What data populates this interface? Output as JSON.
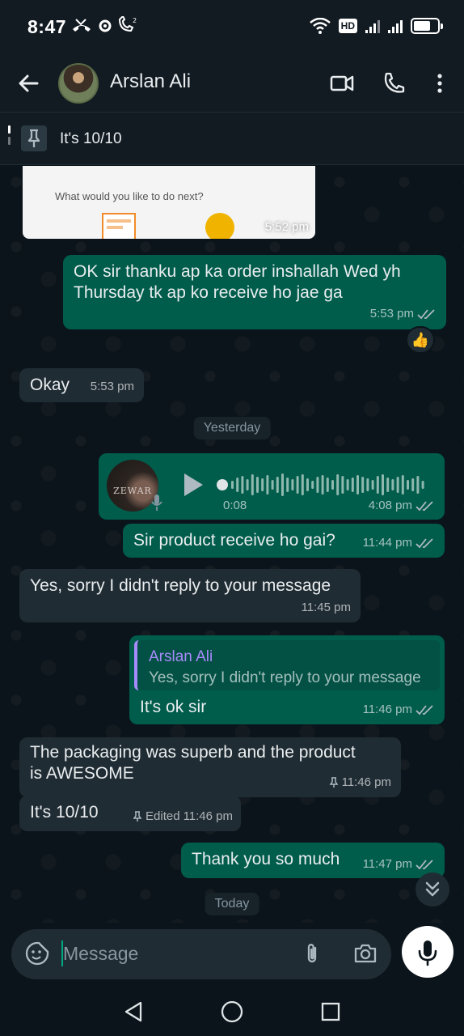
{
  "status_bar": {
    "time": "8:47",
    "icons_left": [
      "missed-call-icon",
      "settings-icon",
      "wifi-calling-icon"
    ],
    "hd_label": "HD",
    "battery_level": 0.7
  },
  "header": {
    "contact_name": "Arslan Ali",
    "icons": [
      "back-arrow-icon",
      "video-call-icon",
      "phone-icon",
      "more-vert-icon"
    ]
  },
  "pinned": {
    "text": "It's 10/10"
  },
  "chat": {
    "image_message": {
      "caption_text": "What would you like to do next?",
      "time": "5:52 pm"
    },
    "msg1": {
      "line1": "OK sir thanku ap ka order inshallah Wed yh",
      "line2": "Thursday tk ap ko receive ho jae ga",
      "time": "5:53 pm",
      "reaction": "👍"
    },
    "msg2": {
      "text": "Okay",
      "time": "5:53 pm"
    },
    "date_yesterday": "Yesterday",
    "voice": {
      "avatar_text": "ZEWAR",
      "duration": "0:08",
      "time": "4:08 pm"
    },
    "msg3": {
      "text": "Sir product receive ho gai?",
      "time": "11:44 pm"
    },
    "msg4": {
      "text": "Yes, sorry I didn't reply to your message",
      "time": "11:45 pm"
    },
    "msg5": {
      "quote_author": "Arslan Ali",
      "quote_text": "Yes, sorry I didn't reply to your message",
      "text": "It's ok sir",
      "time": "11:46 pm"
    },
    "msg6": {
      "line1": "The packaging was superb and the product",
      "line2": "is AWESOME",
      "time": "11:46 pm"
    },
    "msg7": {
      "text": "It's 10/10",
      "edited_label": "Edited",
      "time": "11:46 pm"
    },
    "msg8": {
      "text": "Thank you so much",
      "time": "11:47 pm"
    },
    "date_today": "Today"
  },
  "input": {
    "placeholder": "Message"
  },
  "colors": {
    "outgoing": "#005c4b",
    "incoming": "#202c33",
    "background": "#0b141a",
    "accent": "#00a884"
  }
}
